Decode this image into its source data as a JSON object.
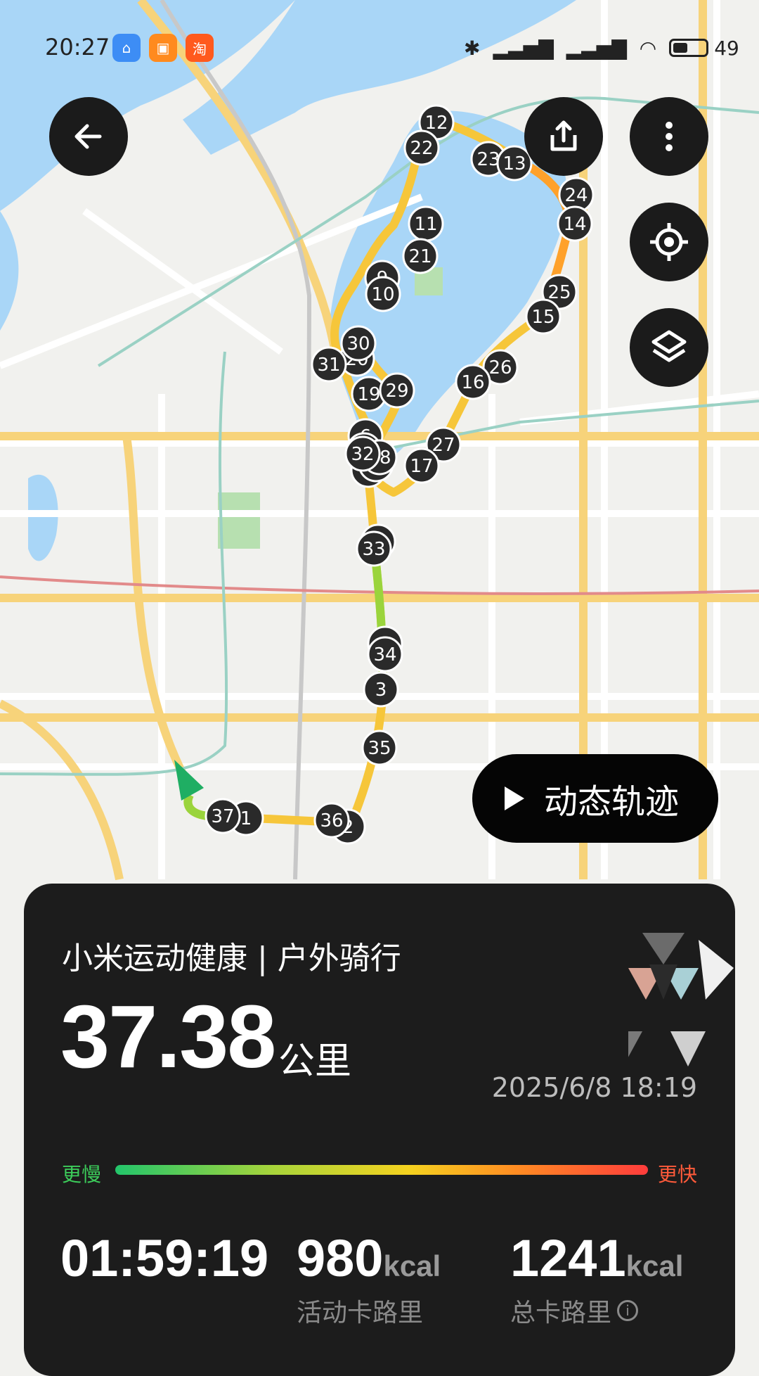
{
  "status_bar": {
    "time": "20:27",
    "battery": "49",
    "apps": [
      {
        "icon": "game-icon",
        "color": "#3d8df5"
      },
      {
        "icon": "shop-icon",
        "color": "#ff8a1e"
      },
      {
        "icon": "taobao-icon",
        "text": "淘",
        "color": "#ff5a1e"
      }
    ]
  },
  "map": {
    "markers": [
      "1",
      "2",
      "3",
      "4",
      "5",
      "6",
      "7",
      "8",
      "9",
      "10",
      "11",
      "12",
      "13",
      "14",
      "15",
      "16",
      "17",
      "18",
      "19",
      "20",
      "21",
      "22",
      "23",
      "24",
      "25",
      "26",
      "27",
      "28",
      "29",
      "30",
      "31",
      "32",
      "33",
      "34",
      "35",
      "36",
      "37"
    ]
  },
  "controls": {
    "back_icon": "arrow-left-icon",
    "share_icon": "share-icon",
    "more_icon": "more-vertical-icon",
    "locate_icon": "locate-icon",
    "layers_icon": "layers-icon",
    "play_label": "动态轨迹"
  },
  "summary": {
    "title": "小米运动健康 | 户外骑行",
    "distance": "37.38",
    "distance_unit": "公里",
    "date": "2025/6/8 18:19",
    "speed_slow": "更慢",
    "speed_fast": "更快",
    "stats": [
      {
        "value": "01:59:19",
        "unit": "",
        "label": ""
      },
      {
        "value": "980",
        "unit": "kcal",
        "label": "活动卡路里"
      },
      {
        "value": "1241",
        "unit": "kcal",
        "label": "总卡路里"
      }
    ]
  },
  "colors": {
    "route": "#f6c63a",
    "route_fast": "#ffa12a",
    "route_slow": "#9ad43c",
    "marker": "#2a2a2a",
    "water": "#a9d6f7",
    "card": "#1c1c1c"
  }
}
